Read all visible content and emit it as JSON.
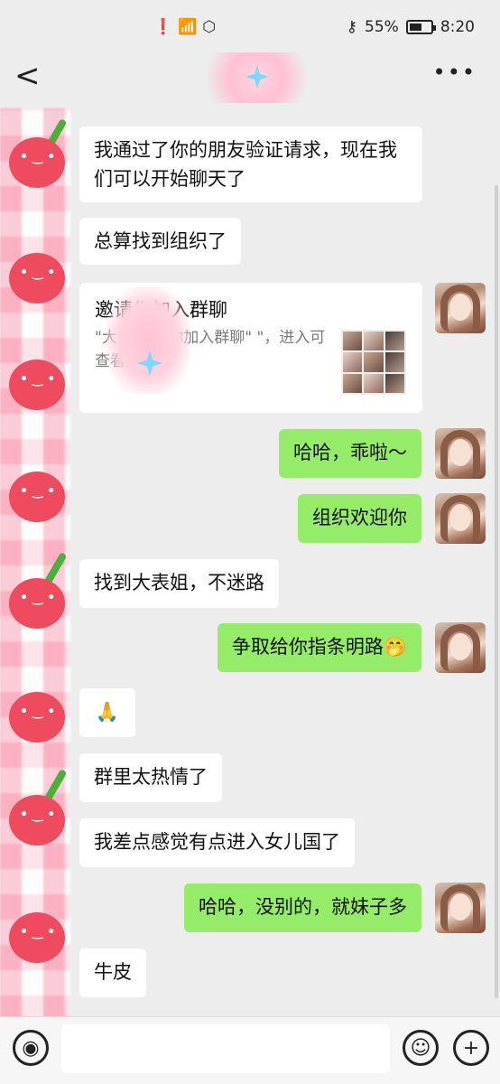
{
  "status_bar": {
    "battery": "55%",
    "time": "8:20"
  },
  "nav": {
    "back_glyph": "<",
    "more_glyph": "•••"
  },
  "messages": [
    {
      "side": "in",
      "text": "我通过了你的朋友验证请求，现在我们可以开始聊天了"
    },
    {
      "side": "in",
      "text": "总算找到组织了"
    },
    {
      "side": "out",
      "text": "哈哈，乖啦～"
    },
    {
      "side": "out",
      "text": "组织欢迎你"
    },
    {
      "side": "in",
      "text": "找到大表姐，不迷路"
    },
    {
      "side": "out",
      "text": "争取给你指条明路🤭"
    },
    {
      "side": "in",
      "text": "🙏"
    },
    {
      "side": "in",
      "text": "群里太热情了"
    },
    {
      "side": "in",
      "text": "我差点感觉有点进入女儿国了"
    },
    {
      "side": "out",
      "text": "哈哈，没别的，就妹子多"
    },
    {
      "side": "in",
      "text": "牛皮"
    }
  ],
  "invite_card": {
    "title": "邀请你加入群聊",
    "description": "\"大表       邀请你加入群聊\"          \"，进入可查看详情。"
  },
  "input_bar": {
    "voice_icon": "voice-icon",
    "emoji_icon": "emoji-icon",
    "plus_icon": "plus-icon"
  },
  "colors": {
    "outgoing_bubble": "#95ec69",
    "incoming_bubble": "#ffffff",
    "background": "#ededed"
  }
}
